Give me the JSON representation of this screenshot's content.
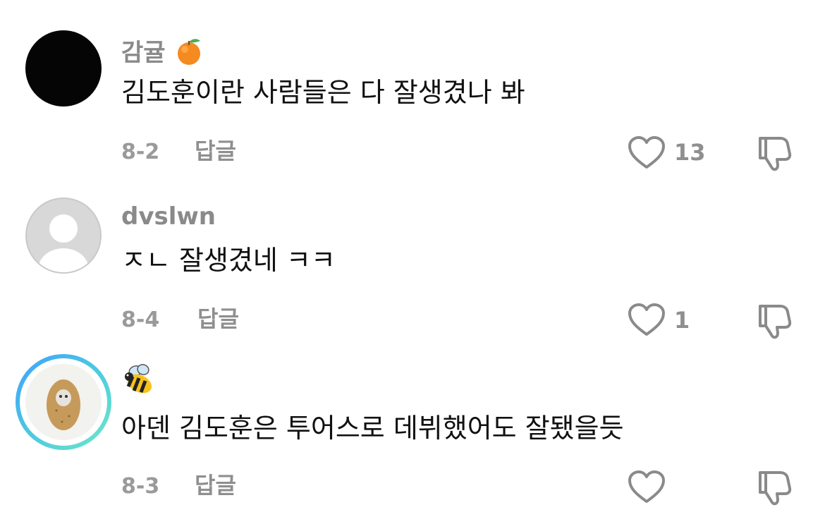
{
  "comments": [
    {
      "username": "감귤",
      "username_emoji_icon": "tangerine-icon",
      "text": "김도훈이란 사람들은 다 잘생겼나 봐",
      "date": "8-2",
      "reply_label": "답글",
      "like_count": "13"
    },
    {
      "username": "dvslwn",
      "text": "ㅈㄴ 잘생겼네 ㅋㅋ",
      "date": "8-4",
      "reply_label": "답글",
      "like_count": "1"
    },
    {
      "username_emoji_icon": "bee-icon",
      "text": "아덴 김도훈은 투어스로 데뷔했어도 잘됐을듯",
      "date": "8-3",
      "reply_label": "답글",
      "like_count": ""
    }
  ],
  "colors": {
    "text": "#111111",
    "muted": "#8f8f8f",
    "ring_start": "#3fa0ff",
    "ring_end": "#6ee8c8"
  }
}
